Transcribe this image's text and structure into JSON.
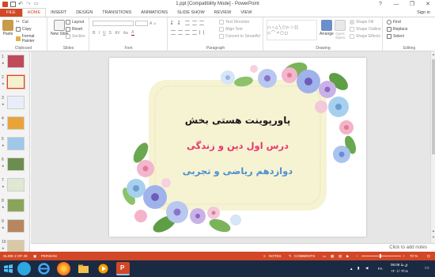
{
  "app": {
    "title": "1.ppt [Compatibility Mode] - PowerPoint",
    "signin": "Sign in",
    "window_controls": [
      "?",
      "—",
      "❐",
      "✕"
    ]
  },
  "tabs": [
    "FILE",
    "HOME",
    "INSERT",
    "DESIGN",
    "TRANSITIONS",
    "ANIMATIONS",
    "SLIDE SHOW",
    "REVIEW",
    "VIEW"
  ],
  "active_tab": "HOME",
  "ribbon": {
    "clipboard": {
      "label": "Clipboard",
      "paste": "Paste",
      "cut": "Cut",
      "copy": "Copy",
      "format_painter": "Format Painter"
    },
    "slides": {
      "label": "Slides",
      "new_slide": "New Slide",
      "layout": "Layout",
      "reset": "Reset",
      "section": "Section"
    },
    "font": {
      "label": "Font"
    },
    "paragraph": {
      "label": "Paragraph",
      "text_direction": "Text Direction",
      "align_text": "Align Text",
      "convert_smartart": "Convert to SmartArt"
    },
    "drawing": {
      "label": "Drawing",
      "arrange": "Arrange",
      "quick_styles": "Quick Styles",
      "shape_fill": "Shape Fill",
      "shape_outline": "Shape Outline",
      "shape_effects": "Shape Effects"
    },
    "editing": {
      "label": "Editing",
      "find": "Find",
      "replace": "Replace",
      "select": "Select"
    }
  },
  "thumbnails": [
    {
      "num": "1",
      "star": "★",
      "color": "#c04a5a"
    },
    {
      "num": "2",
      "star": "★",
      "color": "#f4f0d0",
      "selected": true
    },
    {
      "num": "3",
      "star": "★",
      "color": "#e8eef7"
    },
    {
      "num": "4",
      "star": "★",
      "color": "#e9a33a"
    },
    {
      "num": "5",
      "star": "★",
      "color": "#9fc7ea"
    },
    {
      "num": "6",
      "star": "★",
      "color": "#6b8e4e"
    },
    {
      "num": "7",
      "star": "★",
      "color": "#dfe8d0"
    },
    {
      "num": "8",
      "star": "★",
      "color": "#8aa55a"
    },
    {
      "num": "9",
      "star": "★",
      "color": "#b7865f"
    },
    {
      "num": "10",
      "star": "★",
      "color": "#d7c9a6"
    }
  ],
  "slide": {
    "title": "پاورپوینت هستی بخش",
    "line2": "درس اول دین و زندگی",
    "line3": "دوازدهم ریاضی و تجربی",
    "title_color": "#1a1a1a",
    "line2_color": "#e8356e",
    "line3_color": "#4a8fd0"
  },
  "notes_placeholder": "Click to add notes",
  "status": {
    "slide_info": "SLIDE 2 OF 29",
    "language": "PERSIAN",
    "notes": "NOTES",
    "comments": "COMMENTS",
    "zoom": "70 %"
  },
  "taskbar": {
    "lang": "FA",
    "time": "06:08 ق.ظ",
    "date": "۱۴۰۱/۰۴/۱۸"
  },
  "colors": {
    "accent": "#d24726",
    "taskbar": "#1b2a43"
  }
}
